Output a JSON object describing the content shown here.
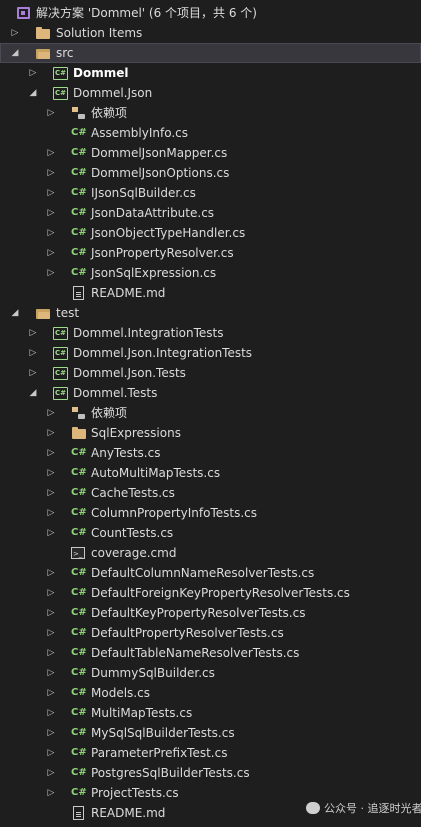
{
  "solution": {
    "label": "解决方案 'Dommel' (6 个项目，共 6 个)"
  },
  "nodes": {
    "solution_items": "Solution Items",
    "src": "src",
    "dommel": "Dommel",
    "dommel_json": "Dommel.Json",
    "deps1": "依赖项",
    "f1": "AssemblyInfo.cs",
    "f2": "DommelJsonMapper.cs",
    "f3": "DommelJsonOptions.cs",
    "f4": "IJsonSqlBuilder.cs",
    "f5": "JsonDataAttribute.cs",
    "f6": "JsonObjectTypeHandler.cs",
    "f7": "JsonPropertyResolver.cs",
    "f8": "JsonSqlExpression.cs",
    "readme1": "README.md",
    "test": "test",
    "p1": "Dommel.IntegrationTests",
    "p2": "Dommel.Json.IntegrationTests",
    "p3": "Dommel.Json.Tests",
    "p4": "Dommel.Tests",
    "deps2": "依赖项",
    "sqlexp": "SqlExpressions",
    "t1": "AnyTests.cs",
    "t2": "AutoMultiMapTests.cs",
    "t3": "CacheTests.cs",
    "t4": "ColumnPropertyInfoTests.cs",
    "t5": "CountTests.cs",
    "t6": "coverage.cmd",
    "t7": "DefaultColumnNameResolverTests.cs",
    "t8": "DefaultForeignKeyPropertyResolverTests.cs",
    "t9": "DefaultKeyPropertyResolverTests.cs",
    "t10": "DefaultPropertyResolverTests.cs",
    "t11": "DefaultTableNameResolverTests.cs",
    "t12": "DummySqlBuilder.cs",
    "t13": "Models.cs",
    "t14": "MultiMapTests.cs",
    "t15": "MySqlSqlBuilderTests.cs",
    "t16": "ParameterPrefixTest.cs",
    "t17": "PostgresSqlBuilderTests.cs",
    "t18": "ProjectTests.cs",
    "readme2": "README.md"
  },
  "icons": {
    "cs": "C#",
    "project": "C#",
    "expanded": "◢",
    "collapsed": "▷"
  },
  "watermark": {
    "text": "公众号 · 追逐时光者"
  }
}
